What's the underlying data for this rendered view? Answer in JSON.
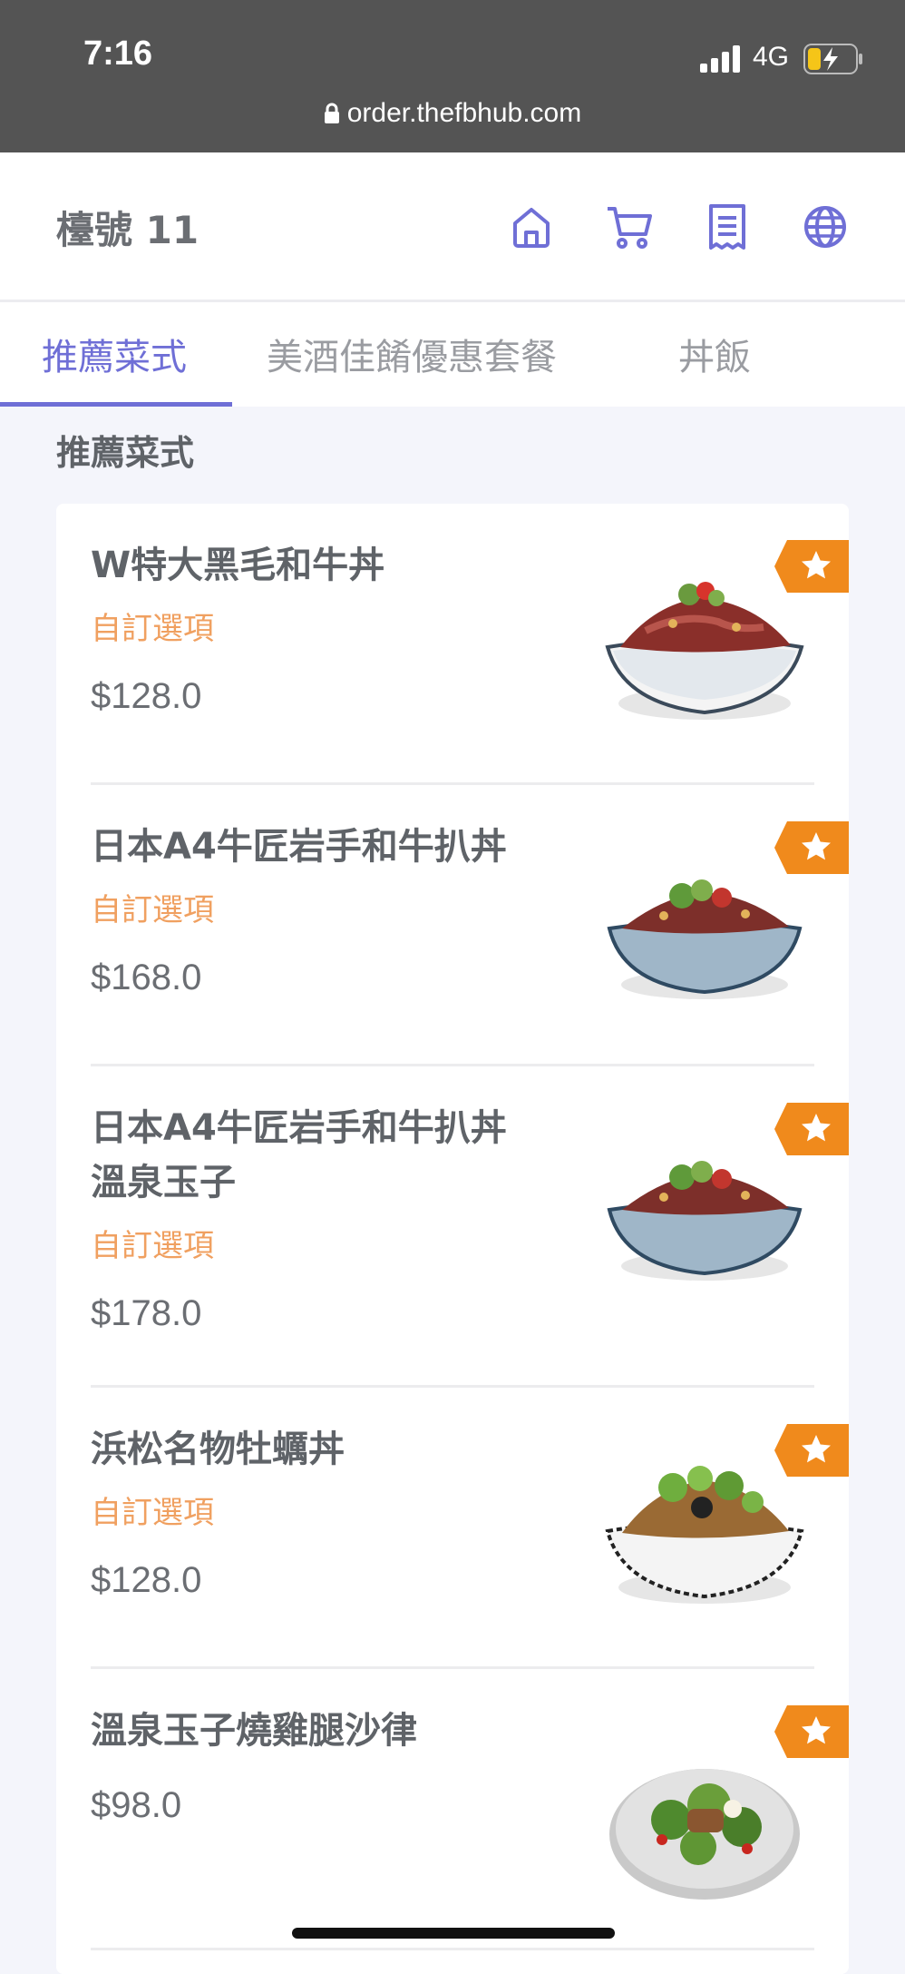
{
  "status_bar": {
    "time": "7:16",
    "network": "4G",
    "url": "order.thefbhub.com"
  },
  "header": {
    "title": "檯號 11",
    "icons": [
      "home-icon",
      "cart-icon",
      "receipt-icon",
      "globe-icon"
    ]
  },
  "tabs": [
    {
      "label": "推薦菜式",
      "active": true
    },
    {
      "label": "美酒佳餚優惠套餐",
      "active": false
    },
    {
      "label": "丼飯",
      "active": false
    }
  ],
  "section_title": "推薦菜式",
  "menu_items": [
    {
      "name": "W特大黑毛和牛丼",
      "option": "自訂選項",
      "price": "$128.0"
    },
    {
      "name": "日本A4牛匠岩手和牛扒丼",
      "option": "自訂選項",
      "price": "$168.0"
    },
    {
      "name_line1": "日本A4牛匠岩手和牛扒丼",
      "name_line2": "溫泉玉子",
      "option": "自訂選項",
      "price": "$178.0"
    },
    {
      "name": "浜松名物牡蠣丼",
      "option": "自訂選項",
      "price": "$128.0"
    },
    {
      "name": "溫泉玉子燒雞腿沙律",
      "price": "$98.0"
    }
  ],
  "colors": {
    "accent": "#6f6fd6",
    "option": "#f0a060",
    "badge": "#f08a1c",
    "statusbar": "#545454"
  }
}
